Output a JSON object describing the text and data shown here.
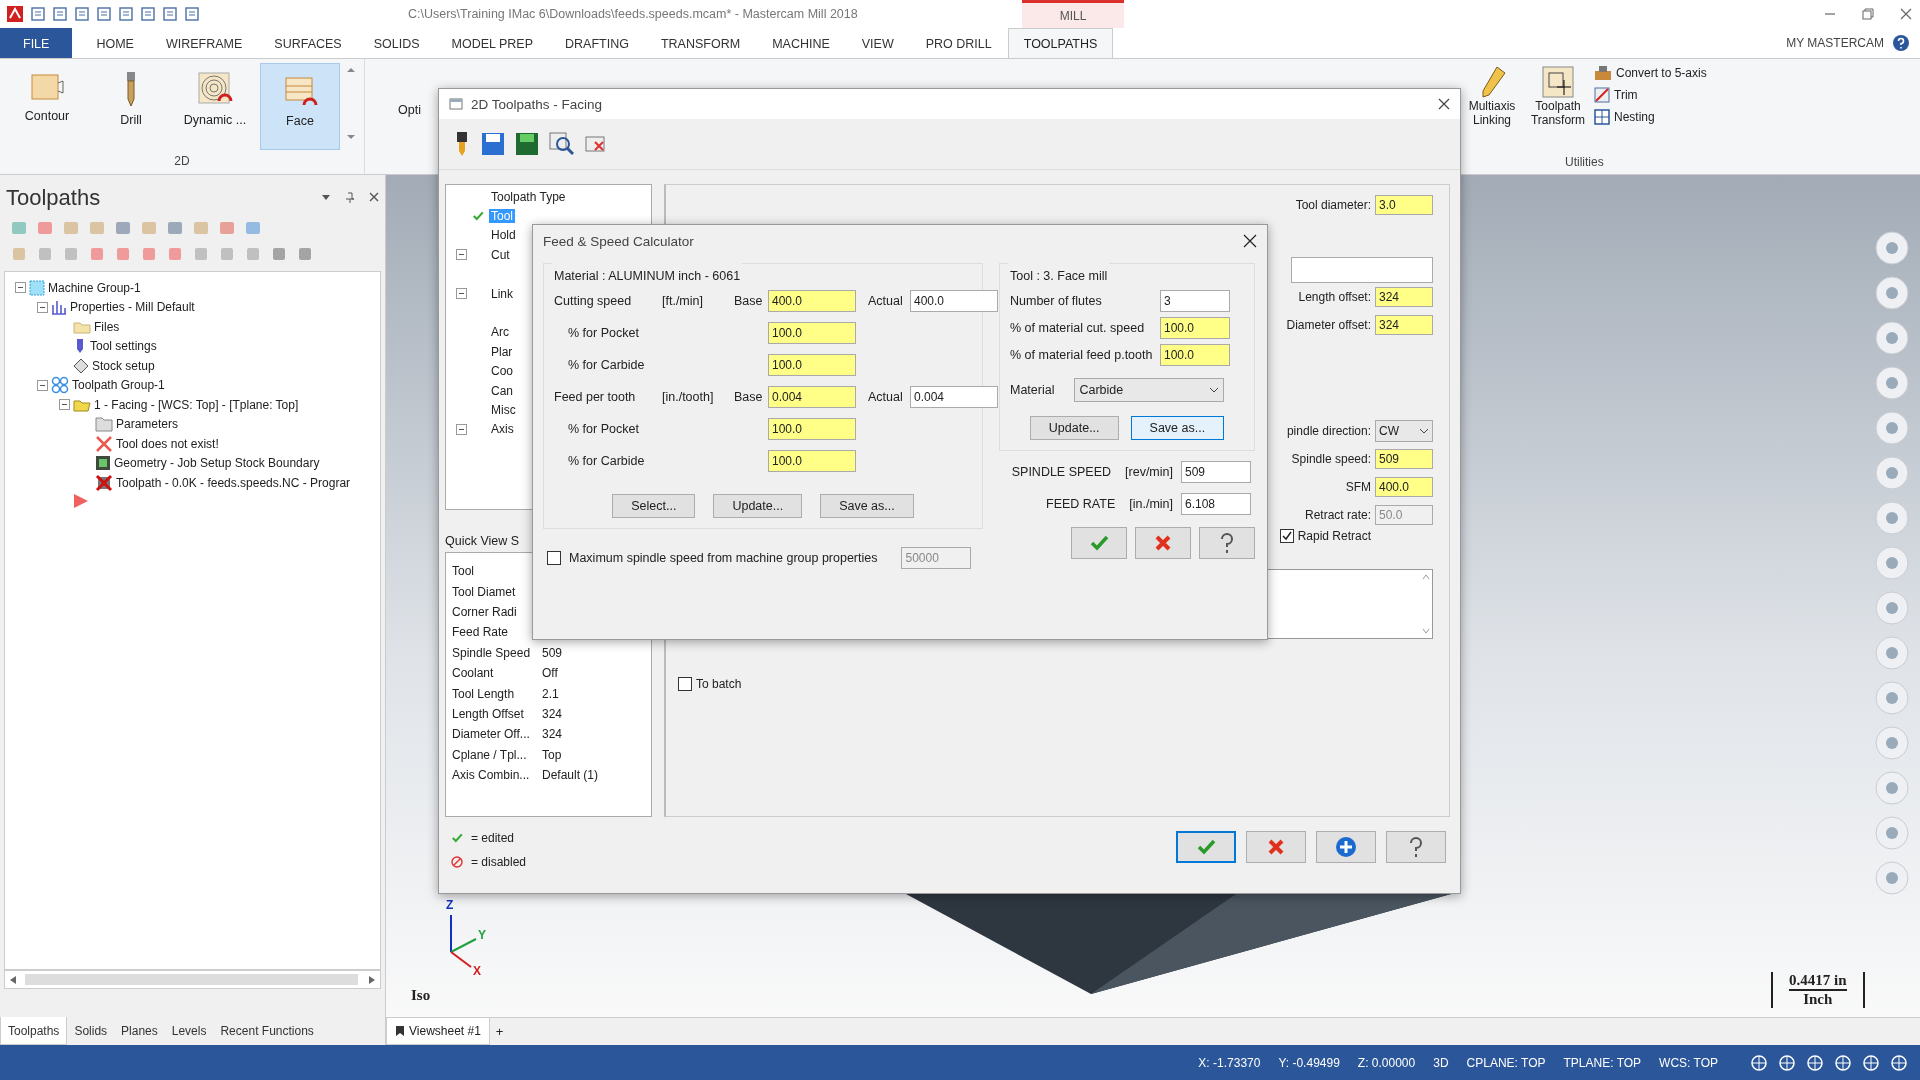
{
  "title_bar": {
    "path": "C:\\Users\\Training IMac 6\\Downloads\\feeds.speeds.mcam* - Mastercam Mill 2018",
    "context_tab": "MILL"
  },
  "ribbon_tabs": [
    {
      "label": "FILE",
      "kind": "file",
      "selected": false
    },
    {
      "label": "HOME",
      "kind": "tab",
      "selected": false
    },
    {
      "label": "WIREFRAME",
      "kind": "tab",
      "selected": false
    },
    {
      "label": "SURFACES",
      "kind": "tab",
      "selected": false
    },
    {
      "label": "SOLIDS",
      "kind": "tab",
      "selected": false
    },
    {
      "label": "MODEL PREP",
      "kind": "tab",
      "selected": false
    },
    {
      "label": "DRAFTING",
      "kind": "tab",
      "selected": false
    },
    {
      "label": "TRANSFORM",
      "kind": "tab",
      "selected": false
    },
    {
      "label": "MACHINE",
      "kind": "tab",
      "selected": false
    },
    {
      "label": "VIEW",
      "kind": "tab",
      "selected": false
    },
    {
      "label": "PRO DRILL",
      "kind": "tab",
      "selected": false
    },
    {
      "label": "TOOLPATHS",
      "kind": "tab",
      "selected": true
    }
  ],
  "account": "MY MASTERCAM",
  "ribbon": {
    "group_2d": {
      "label": "2D",
      "buttons": [
        {
          "label": "Contour",
          "kind": "contour",
          "selected": false
        },
        {
          "label": "Drill",
          "kind": "drill",
          "selected": false
        },
        {
          "label": "Dynamic ...",
          "kind": "dynamic",
          "selected": false
        },
        {
          "label": "Face",
          "kind": "face",
          "selected": true
        }
      ]
    },
    "partial_label": "Opti",
    "utilities": {
      "label": "Utilities",
      "large": [
        {
          "label": "Multiaxis Linking",
          "kind": "linking"
        },
        {
          "label": "Toolpath Transform",
          "kind": "transform"
        }
      ],
      "small": [
        {
          "label": "Convert to 5-axis",
          "kind": "convert"
        },
        {
          "label": "Trim",
          "kind": "trim"
        },
        {
          "label": "Nesting",
          "kind": "nesting"
        }
      ]
    }
  },
  "toolpaths_panel": {
    "title": "Toolpaths",
    "tree": [
      {
        "label": "Machine Group-1",
        "kind": "machine",
        "expanded": true,
        "children": [
          {
            "label": "Properties - Mill Default",
            "kind": "properties",
            "expanded": true,
            "children": [
              {
                "label": "Files",
                "kind": "files"
              },
              {
                "label": "Tool settings",
                "kind": "tool"
              },
              {
                "label": "Stock setup",
                "kind": "stock"
              }
            ]
          },
          {
            "label": "Toolpath Group-1",
            "kind": "group",
            "expanded": true,
            "children": [
              {
                "label": "1 - Facing - [WCS: Top] - [Tplane: Top]",
                "kind": "operation",
                "expanded": true,
                "children": [
                  {
                    "label": "Parameters",
                    "kind": "parameters"
                  },
                  {
                    "label": "Tool does not exist!",
                    "kind": "error"
                  },
                  {
                    "label": "Geometry - Job Setup Stock Boundary",
                    "kind": "geometry"
                  },
                  {
                    "label": "Toolpath - 0.0K - feeds.speeds.NC - Prograr",
                    "kind": "toolpath"
                  }
                ]
              }
            ]
          }
        ]
      }
    ],
    "tabs": [
      {
        "label": "Toolpaths",
        "selected": true
      },
      {
        "label": "Solids",
        "selected": false
      },
      {
        "label": "Planes",
        "selected": false
      },
      {
        "label": "Levels",
        "selected": false
      },
      {
        "label": "Recent Functions",
        "selected": false
      }
    ]
  },
  "viewport": {
    "view_label": "Iso",
    "axes": [
      "Z",
      "Y",
      "X"
    ],
    "scale": {
      "value": "0.4417 in",
      "unit": "Inch"
    },
    "viewsheet_tabs": [
      {
        "label": "Viewsheet #1",
        "selected": true
      }
    ],
    "add_tab": "+"
  },
  "facing_dialog": {
    "title": "2D Toolpaths - Facing",
    "tree": [
      {
        "label": "Toolpath Type",
        "kind": "leaf",
        "edited": false,
        "selected": false
      },
      {
        "label": "Tool",
        "kind": "leaf",
        "edited": true,
        "selected": true
      },
      {
        "label": "Hold",
        "kind": "leaf",
        "edited": false,
        "selected": false
      },
      {
        "label": "Cut",
        "kind": "group",
        "expanded": true,
        "edited": false,
        "selected": false
      },
      {
        "label": "Link",
        "kind": "group",
        "expanded": true,
        "edited": false,
        "selected": false
      },
      {
        "label": "Arc",
        "kind": "leaf",
        "edited": false,
        "selected": false
      },
      {
        "label": "Plar",
        "kind": "leaf",
        "edited": false,
        "selected": false
      },
      {
        "label": "Coo",
        "kind": "leaf",
        "edited": false,
        "selected": false
      },
      {
        "label": "Can",
        "kind": "leaf",
        "edited": false,
        "selected": false
      },
      {
        "label": "Misc",
        "kind": "leaf",
        "edited": false,
        "selected": false
      },
      {
        "label": "Axis",
        "kind": "group",
        "expanded": true,
        "edited": false,
        "selected": false
      }
    ],
    "quick_view": {
      "label": "Quick View S",
      "rows": [
        {
          "name": "Tool"
        },
        {
          "name": "Tool Diamet"
        },
        {
          "name": "Corner Radi"
        },
        {
          "name": "Feed Rate"
        },
        {
          "name": "Spindle Speed",
          "value": "509"
        },
        {
          "name": "Coolant",
          "value": "Off"
        },
        {
          "name": "Tool Length",
          "value": "2.1"
        },
        {
          "name": "Length Offset",
          "value": "324"
        },
        {
          "name": "Diameter Off...",
          "value": "324"
        },
        {
          "name": "Cplane / Tpl...",
          "value": "Top"
        },
        {
          "name": "Axis Combin...",
          "value": "Default (1)"
        }
      ]
    },
    "tool_fields": [
      {
        "label": "Tool diameter:",
        "value": "3.0",
        "edited": true
      }
    ],
    "offset_fields": [
      {
        "label": "Length offset:",
        "value": "324",
        "edited": true
      },
      {
        "label": "Diameter offset:",
        "value": "324",
        "edited": true
      }
    ],
    "spindle_direction": {
      "label": "pindle direction:",
      "value": "CW"
    },
    "speed_fields": [
      {
        "label": "Spindle speed:",
        "value": "509",
        "edited": true,
        "disabled": false
      },
      {
        "label": "SFM",
        "value": "400.0",
        "edited": true,
        "disabled": false
      },
      {
        "label": "Retract rate:",
        "value": "50.0",
        "edited": false,
        "disabled": true
      }
    ],
    "rapid_retract": {
      "label": "Rapid Retract",
      "checked": true
    },
    "to_batch": {
      "label": "To batch",
      "checked": false
    },
    "legend": [
      {
        "label": "= edited",
        "kind": "edited"
      },
      {
        "label": "= disabled",
        "kind": "disabled"
      }
    ]
  },
  "calculator": {
    "title": "Feed & Speed Calculator",
    "material_group": {
      "title": "Material : ALUMINUM inch - 6061",
      "sections": [
        {
          "label": "Cutting speed",
          "unit": "[ft./min]",
          "base_label": "Base",
          "base": {
            "value": "400.0",
            "edited": true
          },
          "actual_label": "Actual",
          "actual": {
            "value": "400.0",
            "edited": false
          },
          "percentages": [
            {
              "label": "% for Pocket",
              "value": "100.0",
              "edited": true
            },
            {
              "label": "% for Carbide",
              "value": "100.0",
              "edited": true
            }
          ]
        },
        {
          "label": "Feed per tooth",
          "unit": "[in./tooth]",
          "base_label": "Base",
          "base": {
            "value": "0.004",
            "edited": true
          },
          "actual_label": "Actual",
          "actual": {
            "value": "0.004",
            "edited": false
          },
          "percentages": [
            {
              "label": "% for Pocket",
              "value": "100.0",
              "edited": true
            },
            {
              "label": "% for Carbide",
              "value": "100.0",
              "edited": true
            }
          ]
        }
      ],
      "buttons": [
        {
          "label": "Select...",
          "focused": false
        },
        {
          "label": "Update...",
          "focused": false
        },
        {
          "label": "Save as...",
          "focused": false
        }
      ]
    },
    "tool_group": {
      "title": "Tool : 3. Face mill",
      "fields": [
        {
          "label": "Number of flutes",
          "value": "3",
          "edited": false
        },
        {
          "label": "% of material cut. speed",
          "value": "100.0",
          "edited": true
        },
        {
          "label": "% of material feed p.tooth",
          "value": "100.0",
          "edited": true
        }
      ],
      "material": {
        "label": "Material",
        "value": "Carbide"
      },
      "buttons": [
        {
          "label": "Update...",
          "focused": false
        },
        {
          "label": "Save as...",
          "focused": true
        }
      ]
    },
    "results": [
      {
        "label": "SPINDLE SPEED",
        "unit": "[rev/min]",
        "value": "509"
      },
      {
        "label": "FEED RATE",
        "unit": "[in./min]",
        "value": "6.108"
      }
    ],
    "max_spindle": {
      "label": "Maximum spindle speed from machine group properties",
      "checked": false,
      "value": "50000"
    }
  },
  "status_bar": {
    "coordinates": [
      {
        "label": "X:",
        "value": "-1.73370"
      },
      {
        "label": "Y:",
        "value": "-0.49499"
      },
      {
        "label": "Z:",
        "value": "0.00000"
      }
    ],
    "items": [
      "3D",
      "CPLANE: TOP",
      "TPLANE: TOP",
      "WCS: TOP"
    ]
  }
}
